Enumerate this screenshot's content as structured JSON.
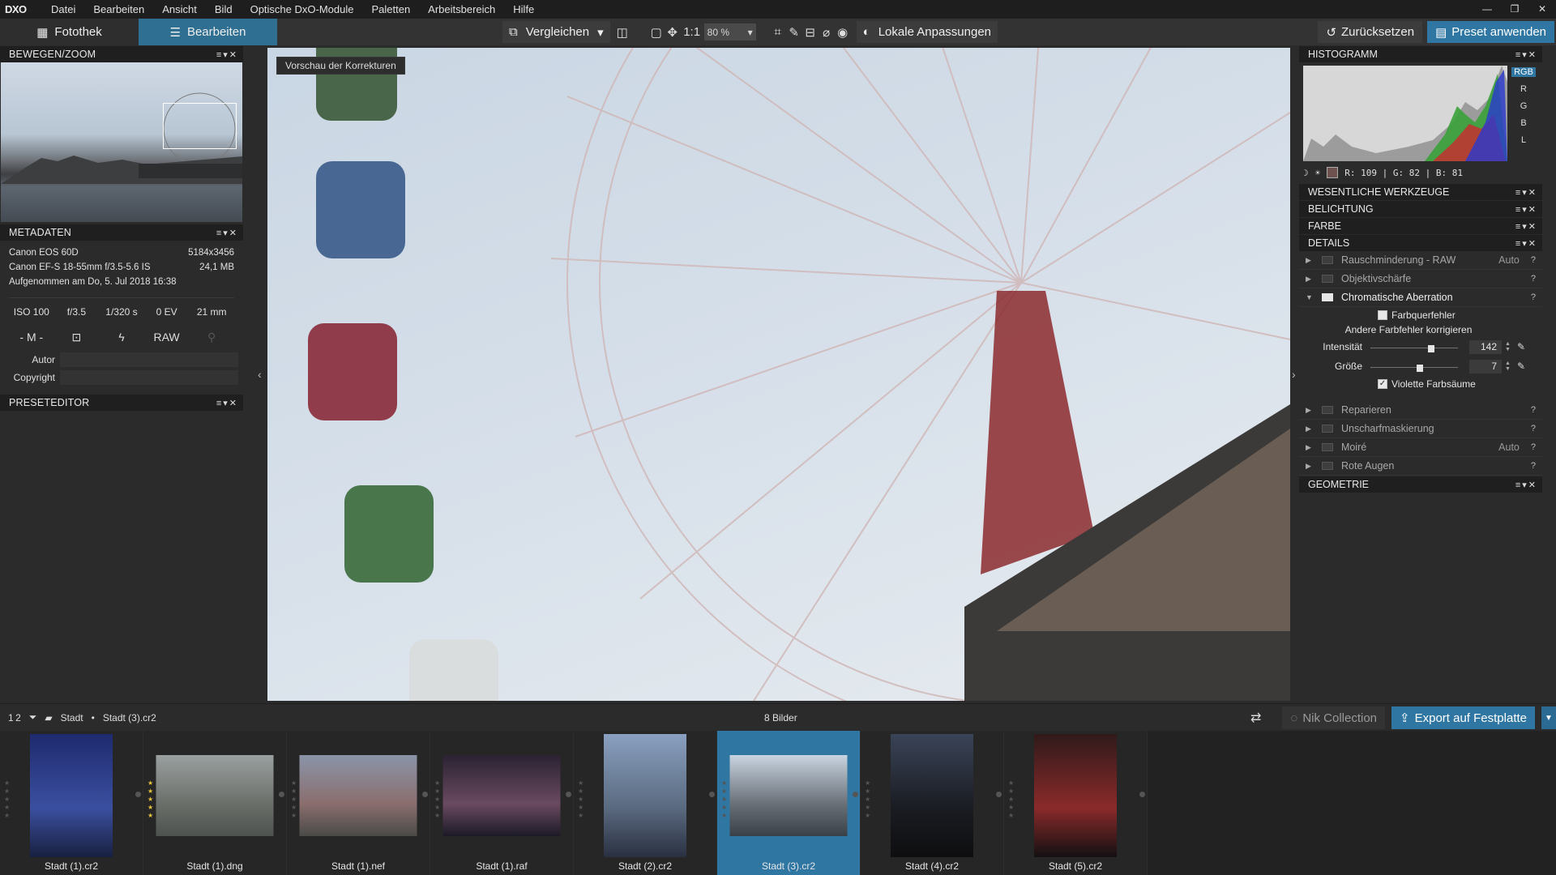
{
  "menubar": {
    "logo": "DXO",
    "items": [
      "Datei",
      "Bearbeiten",
      "Ansicht",
      "Bild",
      "Optische DxO-Module",
      "Paletten",
      "Arbeitsbereich",
      "Hilfe"
    ]
  },
  "toolbar": {
    "library": "Fotothek",
    "edit": "Bearbeiten",
    "compare": "Vergleichen",
    "one_to_one": "1:1",
    "zoom": "80 %",
    "local": "Lokale Anpassungen",
    "reset": "Zurücksetzen",
    "preset": "Preset anwenden"
  },
  "left": {
    "nav_title": "BEWEGEN/ZOOM",
    "meta_title": "METADATEN",
    "camera": "Canon EOS 60D",
    "dims": "5184x3456",
    "lens": "Canon EF-S 18-55mm f/3.5-5.6 IS",
    "size": "24,1 MB",
    "taken": "Aufgenommen am Do, 5. Jul 2018 16:38",
    "exif": [
      "ISO 100",
      "f/3.5",
      "1/320 s",
      "0 EV",
      "21 mm"
    ],
    "mode": "- M -",
    "format": "RAW",
    "author_label": "Autor",
    "copyright_label": "Copyright",
    "preset_title": "PRESETEDITOR"
  },
  "viewer": {
    "preview_label": "Vorschau der Korrekturen"
  },
  "right": {
    "hist_title": "HISTOGRAMM",
    "channels": [
      "RGB",
      "R",
      "G",
      "B",
      "L"
    ],
    "hist_info": "R: 109 | G:  82 | B:  81",
    "sections": [
      "WESENTLICHE WERKZEUGE",
      "BELICHTUNG",
      "FARBE",
      "DETAILS"
    ],
    "tools_top": [
      {
        "name": "Rauschminderung - RAW",
        "auto": "Auto"
      },
      {
        "name": "Objektivschärfe",
        "auto": ""
      }
    ],
    "ca": {
      "name": "Chromatische Aberration",
      "opt1": "Farbquerfehler",
      "opt2": "Andere Farbfehler korrigieren",
      "int_label": "Intensität",
      "int_val": "142",
      "int_level": 0.71,
      "size_label": "Größe",
      "size_val": "7",
      "size_level": 0.57,
      "opt3": "Violette Farbsäume"
    },
    "tools_bottom": [
      {
        "name": "Reparieren",
        "auto": ""
      },
      {
        "name": "Unscharfmaskierung",
        "auto": ""
      },
      {
        "name": "Moiré",
        "auto": "Auto"
      },
      {
        "name": "Rote Augen",
        "auto": ""
      }
    ],
    "geometry": "GEOMETRIE"
  },
  "status": {
    "sort": "1 2",
    "folder": "Stadt",
    "file": "Stadt (3).cr2",
    "count": "8 Bilder",
    "nik": "Nik Collection",
    "export": "Export auf Festplatte"
  },
  "filmstrip": [
    {
      "name": "Stadt (1).cr2",
      "stars": "",
      "colors": [
        "#1e2a6e",
        "#3b4fa0",
        "#182040"
      ]
    },
    {
      "name": "Stadt (1).dng",
      "stars": "★\n★\n★\n★\n★",
      "colors": [
        "#9aa0a0",
        "#6b6f6a",
        "#4e524e"
      ]
    },
    {
      "name": "Stadt (1).nef",
      "stars": "",
      "colors": [
        "#8a94a8",
        "#8a6e6e",
        "#4a4a48"
      ]
    },
    {
      "name": "Stadt (1).raf",
      "stars": "",
      "colors": [
        "#2a2232",
        "#6a4a60",
        "#1c1a26"
      ]
    },
    {
      "name": "Stadt (2).cr2",
      "stars": "",
      "colors": [
        "#8aa0c0",
        "#5a6a80",
        "#2a3040"
      ]
    },
    {
      "name": "Stadt (3).cr2",
      "stars": "",
      "colors": [
        "#c8d4e0",
        "#6a7078",
        "#3a4048"
      ]
    },
    {
      "name": "Stadt (4).cr2",
      "stars": "",
      "colors": [
        "#3a4458",
        "#1a1c22",
        "#0e0e10"
      ]
    },
    {
      "name": "Stadt (5).cr2",
      "stars": "",
      "colors": [
        "#301a1a",
        "#8a2a2a",
        "#141012"
      ]
    }
  ]
}
